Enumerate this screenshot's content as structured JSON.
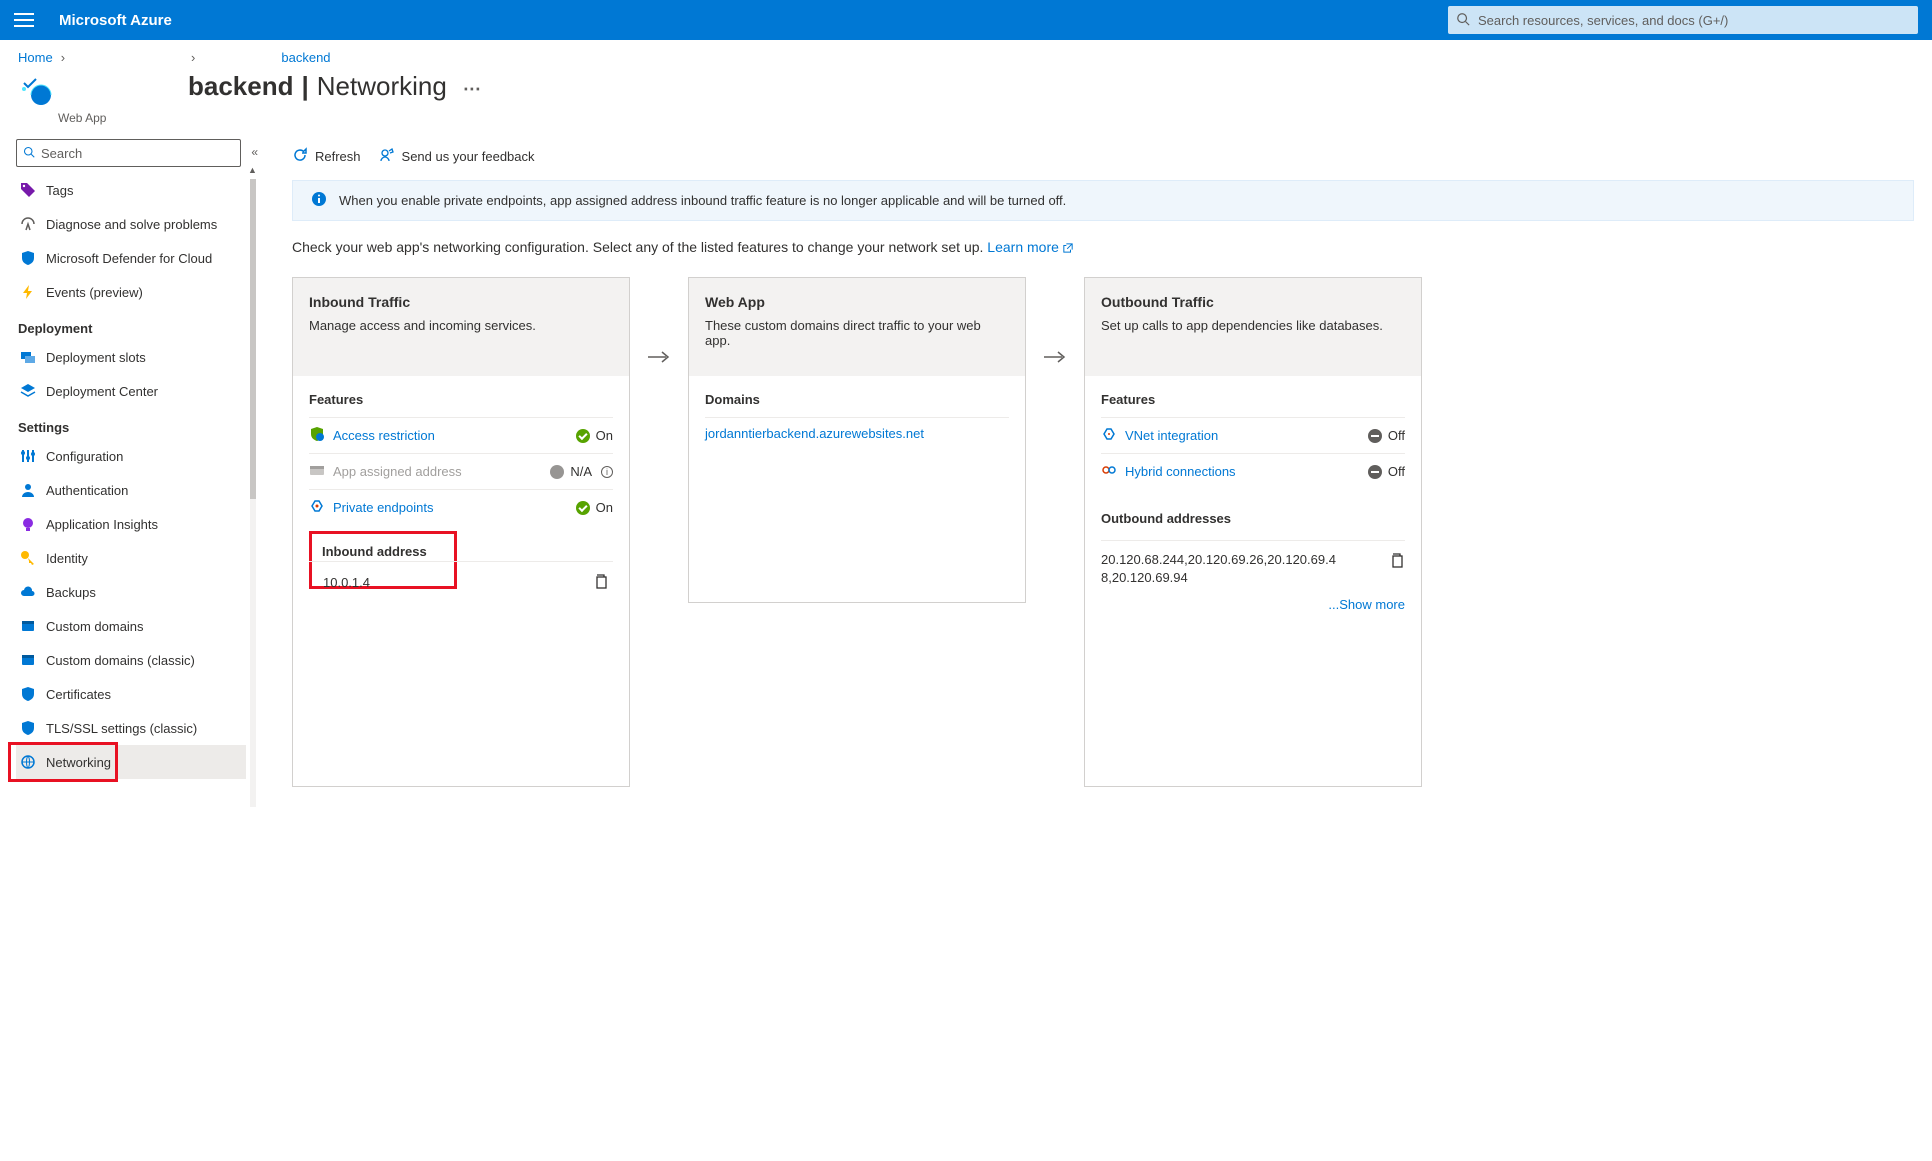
{
  "topbar": {
    "brand": "Microsoft Azure",
    "search_placeholder": "Search resources, services, and docs (G+/)"
  },
  "breadcrumbs": {
    "home": "Home",
    "current": "backend"
  },
  "page": {
    "resource_name": "backend",
    "section": "Networking",
    "resource_type": "Web App"
  },
  "side_search_placeholder": "Search",
  "nav": {
    "items_top": [
      {
        "label": "Tags"
      },
      {
        "label": "Diagnose and solve problems"
      },
      {
        "label": "Microsoft Defender for Cloud"
      },
      {
        "label": "Events (preview)"
      }
    ],
    "group_deploy": "Deployment",
    "items_deploy": [
      {
        "label": "Deployment slots"
      },
      {
        "label": "Deployment Center"
      }
    ],
    "group_settings": "Settings",
    "items_settings": [
      {
        "label": "Configuration"
      },
      {
        "label": "Authentication"
      },
      {
        "label": "Application Insights"
      },
      {
        "label": "Identity"
      },
      {
        "label": "Backups"
      },
      {
        "label": "Custom domains"
      },
      {
        "label": "Custom domains (classic)"
      },
      {
        "label": "Certificates"
      },
      {
        "label": "TLS/SSL settings (classic)"
      },
      {
        "label": "Networking"
      }
    ]
  },
  "toolbar": {
    "refresh": "Refresh",
    "feedback": "Send us your feedback"
  },
  "banner": "When you enable private endpoints, app assigned address inbound traffic feature is no longer applicable and will be turned off.",
  "intro": {
    "text": "Check your web app's networking configuration. Select any of the listed features to change your network set up. ",
    "link": "Learn more"
  },
  "inbound": {
    "title": "Inbound Traffic",
    "subtitle": "Manage access and incoming services.",
    "features_label": "Features",
    "features": [
      {
        "label": "Access restriction",
        "status": "On",
        "state": "on",
        "enabled": true
      },
      {
        "label": "App assigned address",
        "status": "N/A",
        "state": "na",
        "enabled": false
      },
      {
        "label": "Private endpoints",
        "status": "On",
        "state": "on",
        "enabled": true
      }
    ],
    "addr_label": "Inbound address",
    "addr_value": "10.0.1.4"
  },
  "webapp": {
    "title": "Web App",
    "subtitle": "These custom domains direct traffic to your web app.",
    "domains_label": "Domains",
    "domain": "jordanntierbackend.azurewebsites.net"
  },
  "outbound": {
    "title": "Outbound Traffic",
    "subtitle": "Set up calls to app dependencies like databases.",
    "features_label": "Features",
    "features": [
      {
        "label": "VNet integration",
        "status": "Off",
        "state": "off"
      },
      {
        "label": "Hybrid connections",
        "status": "Off",
        "state": "off"
      }
    ],
    "addr_label": "Outbound addresses",
    "addr_value": "20.120.68.244,20.120.69.26,20.120.69.48,20.120.69.94",
    "show_more": "...Show more"
  }
}
